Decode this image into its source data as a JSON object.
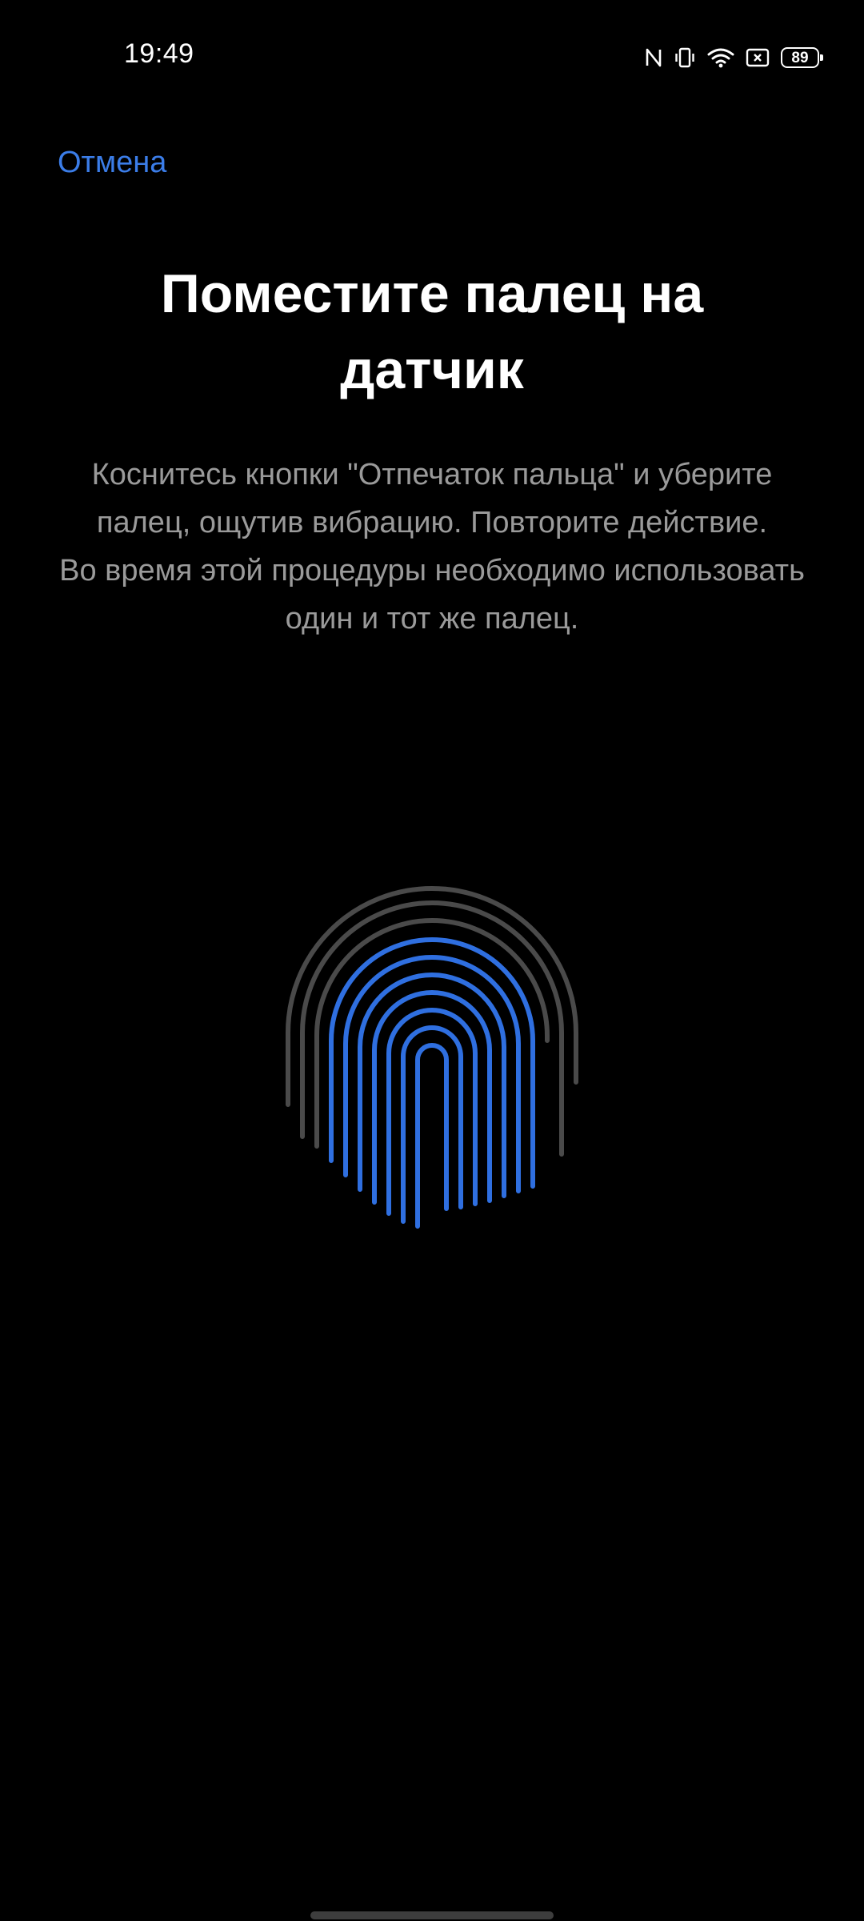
{
  "status_bar": {
    "time": "19:49",
    "battery_level": "89",
    "icons": [
      "nfc-icon",
      "vibrate-icon",
      "wifi-icon",
      "data-saver-icon",
      "battery-icon"
    ]
  },
  "header": {
    "cancel_label": "Отмена"
  },
  "main": {
    "title": "Поместите палец на датчик",
    "description_line1": "Коснитесь кнопки \"Отпечаток пальца\" и уберите палец, ощутив вибрацию. Повторите действие.",
    "description_line2": "Во время этой процедуры необходимо использовать один и тот же палец.",
    "fingerprint_icon": "fingerprint-icon",
    "enrollment_progress": 0.6
  },
  "colors": {
    "background": "#000000",
    "accent": "#3b7de8",
    "fingerprint_active": "#2f6fe0",
    "fingerprint_inactive": "#4a4a4a",
    "description_text": "#9a9a9a"
  }
}
